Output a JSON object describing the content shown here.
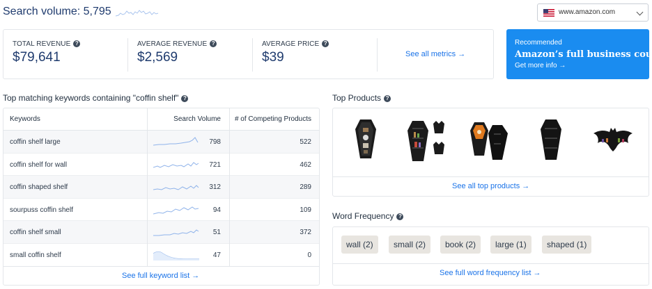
{
  "header": {
    "search_volume_label": "Search volume:",
    "search_volume_value": "5,795"
  },
  "marketplace": {
    "label": "www.amazon.com",
    "flag_icon": "us-flag-icon"
  },
  "metrics": {
    "total_revenue": {
      "label": "TOTAL REVENUE",
      "value": "$79,641"
    },
    "average_revenue": {
      "label": "AVERAGE REVENUE",
      "value": "$2,569"
    },
    "average_price": {
      "label": "AVERAGE PRICE",
      "value": "$39"
    },
    "see_all": "See all metrics →"
  },
  "promo": {
    "tag": "Recommended",
    "title": "Amazon’s full business course",
    "link": "Get more info →"
  },
  "keywords": {
    "title": "Top matching keywords containing \"coffin shelf\"",
    "columns": [
      "Keywords",
      "Search Volume",
      "# of Competing Products"
    ],
    "rows": [
      {
        "keyword": "coffin shelf large",
        "volume": "798",
        "competing": "522"
      },
      {
        "keyword": "coffin shelf for wall",
        "volume": "721",
        "competing": "462"
      },
      {
        "keyword": "coffin shaped shelf",
        "volume": "312",
        "competing": "289"
      },
      {
        "keyword": "sourpuss coffin shelf",
        "volume": "94",
        "competing": "109"
      },
      {
        "keyword": "coffin shelf small",
        "volume": "51",
        "competing": "372"
      },
      {
        "keyword": "small coffin shelf",
        "volume": "47",
        "competing": "0"
      }
    ],
    "link": "See full keyword list →"
  },
  "top_products": {
    "title": "Top Products",
    "link": "See all top products →"
  },
  "word_frequency": {
    "title": "Word Frequency",
    "chips": [
      "wall (2)",
      "small (2)",
      "book (2)",
      "large (1)",
      "shaped (1)"
    ],
    "link": "See full word frequency list →"
  },
  "colors": {
    "accent": "#1a73e8",
    "promo_bg": "#1a8cf0",
    "title": "#1f3b6e",
    "chip_bg": "#e8e5e0"
  }
}
